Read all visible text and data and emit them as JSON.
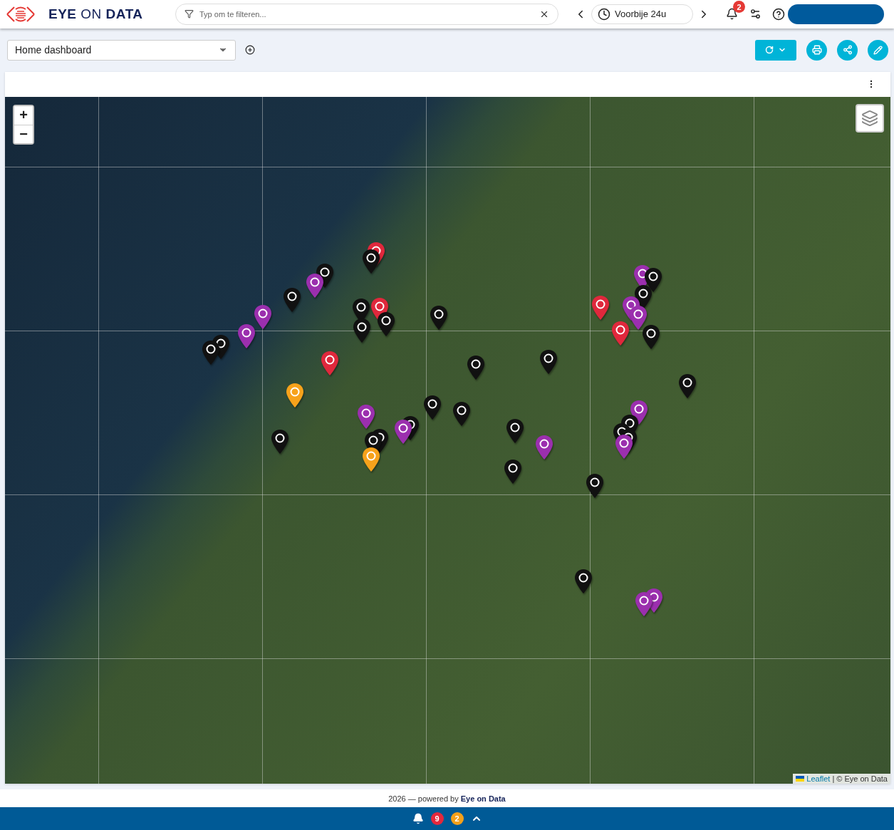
{
  "header": {
    "logo_text": "**EYE** ON **DATA**",
    "search": {
      "placeholder": "Typ om te filteren..."
    },
    "time_range": "Voorbije 24u",
    "notifications_badge": "2"
  },
  "toolbar": {
    "dashboard_select": "Home dashboard"
  },
  "map": {
    "zoom_in": "+",
    "zoom_out": "−",
    "attribution": {
      "link": "Leaflet",
      "text": "| © Eye on Data"
    },
    "markers": [
      {
        "color": "#e0283c"
      },
      {
        "color": "#111111"
      },
      {
        "color": "#111111"
      },
      {
        "color": "#9b2fae"
      },
      {
        "color": "#111111"
      },
      {
        "color": "#9b2fae"
      },
      {
        "color": "#9b2fae"
      },
      {
        "color": "#111111"
      },
      {
        "color": "#111111"
      },
      {
        "color": "#111111"
      },
      {
        "color": "#e0283c"
      },
      {
        "color": "#111111"
      },
      {
        "color": "#111111"
      },
      {
        "color": "#111111"
      },
      {
        "color": "#e0283c"
      },
      {
        "color": "#111111"
      },
      {
        "color": "#111111"
      },
      {
        "color": "#f7a21b"
      },
      {
        "color": "#9b2fae"
      },
      {
        "color": "#111111"
      },
      {
        "color": "#111111"
      },
      {
        "color": "#111111"
      },
      {
        "color": "#9b2fae"
      },
      {
        "color": "#111111"
      },
      {
        "color": "#111111"
      },
      {
        "color": "#f7a21b"
      },
      {
        "color": "#111111"
      },
      {
        "color": "#111111"
      },
      {
        "color": "#9b2fae"
      },
      {
        "color": "#111111"
      },
      {
        "color": "#111111"
      },
      {
        "color": "#e0283c"
      },
      {
        "color": "#9b2fae"
      },
      {
        "color": "#111111"
      },
      {
        "color": "#111111"
      },
      {
        "color": "#9b2fae"
      },
      {
        "color": "#9b2fae"
      },
      {
        "color": "#e0283c"
      },
      {
        "color": "#111111"
      },
      {
        "color": "#111111"
      },
      {
        "color": "#9b2fae"
      },
      {
        "color": "#111111"
      },
      {
        "color": "#111111"
      },
      {
        "color": "#111111"
      },
      {
        "color": "#9b2fae"
      },
      {
        "color": "#111111"
      },
      {
        "color": "#9b2fae"
      },
      {
        "color": "#9b2fae"
      }
    ]
  },
  "footer": {
    "text": "2026 — powered by **Eye on Data**"
  },
  "status_bar": {
    "alerts": [
      {
        "count": "9",
        "color": "#e3283c"
      },
      {
        "count": "2",
        "color": "#f5a01a"
      }
    ]
  }
}
